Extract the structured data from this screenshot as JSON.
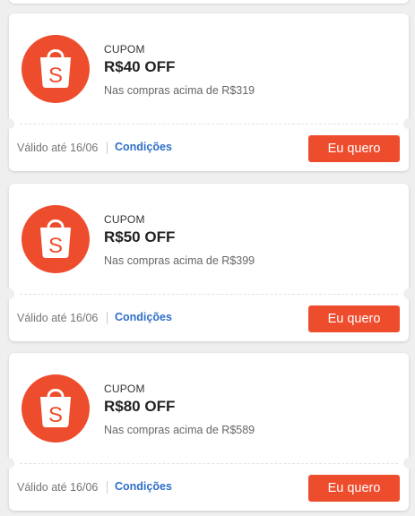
{
  "brand": {
    "accent_color": "#ee4d2d",
    "link_color": "#2f6fc8",
    "logo_icon": "shopee-bag-icon"
  },
  "coupons": [
    {
      "label": "CUPOM",
      "amount": "R$40 OFF",
      "minimum": "Nas compras acima de R$319",
      "validity": "Válido até 16/06",
      "conditions_label": "Condições",
      "cta_label": "Eu quero"
    },
    {
      "label": "CUPOM",
      "amount": "R$50 OFF",
      "minimum": "Nas compras acima de R$399",
      "validity": "Válido até 16/06",
      "conditions_label": "Condições",
      "cta_label": "Eu quero"
    },
    {
      "label": "CUPOM",
      "amount": "R$80 OFF",
      "minimum": "Nas compras acima de R$589",
      "validity": "Válido até 16/06",
      "conditions_label": "Condições",
      "cta_label": "Eu quero"
    }
  ]
}
